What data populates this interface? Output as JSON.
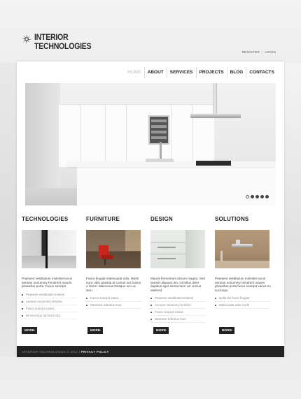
{
  "brand": {
    "line1": "INTERIOR",
    "line2": "TECHNOLOGIES",
    "icon": "sunburst-logo-icon"
  },
  "top_links": {
    "register": "REGISTER",
    "login": "LOGIN",
    "separator": "|"
  },
  "nav": {
    "items": [
      {
        "label": "HOME"
      },
      {
        "label": "ABOUT"
      },
      {
        "label": "SERVICES"
      },
      {
        "label": "PROJECTS"
      },
      {
        "label": "BLOG"
      },
      {
        "label": "CONTACTS"
      }
    ]
  },
  "slider": {
    "count": 5,
    "active": 0
  },
  "columns": [
    {
      "title": "TECHNOLOGIES",
      "text": "Praesent vestibulum molestie lacus aenean nonummy hendrerit mauris phasellus porta. Fusce suscipit.",
      "items": [
        "Praesent vestibulum molesti",
        "Aenean nonummy hendrer",
        "Fusce suscipit varius",
        "Mi sociosqu ad litora torq"
      ],
      "more": "MORE"
    },
    {
      "title": "FURNITURE",
      "text": "Fusce feugiat malesuada odio. Morbi nunc odio gravida at cursus nec luctus a lorem. Maecenas tristique orci ac sem.",
      "items": [
        "Fusce suscipit varius",
        "Nascetur ridiculus mus"
      ],
      "more": "MORE"
    },
    {
      "title": "DESIGN",
      "text": "Mauris fermentum dictum magna. Sed laoreet aliquam leo. Ut tellus dolor dapibus eget elementum vel cursus eleifend.",
      "items": [
        "Praesent vestibulum molesti",
        "Aenean nonummy hendrer",
        "Fusce suscipit varius",
        "Nascetur ridiculus mus"
      ],
      "more": "MORE"
    },
    {
      "title": "SOLUTIONS",
      "text": "Praesent vestibulum molestie lacus aenean nonummy hendrerit mauris phasellus porta fusce suscipit varius mi sociosqu.",
      "items": [
        "Nulla dui fusce feugiat",
        "Malesuada odio morbi"
      ],
      "more": "MORE"
    }
  ],
  "footer": {
    "copyright": "INTERIOR TECHNOLOGIES © 2012",
    "sep": " | ",
    "privacy": "PRIVACY POLICY"
  },
  "colors": {
    "accent": "#222222",
    "background": "#e9e9e9",
    "panel": "#ffffff"
  }
}
